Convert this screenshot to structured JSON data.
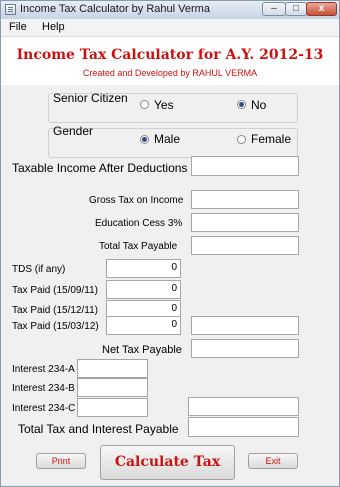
{
  "window": {
    "title": "Income Tax Calculator by Rahul Verma",
    "controls": {
      "minimize": "–",
      "maximize": "□",
      "close": "x"
    }
  },
  "menu": [
    {
      "label": "File"
    },
    {
      "label": "Help"
    }
  ],
  "header": {
    "title": "Income Tax Calculator for A.Y. 2012-13",
    "subtitle": "Created and Developed by RAHUL VERMA"
  },
  "senior_citizen": {
    "label": "Senior Citizen",
    "yes": "Yes",
    "no": "No",
    "selected": "No"
  },
  "gender": {
    "label": "Gender",
    "male": "Male",
    "female": "Female",
    "selected": "Male"
  },
  "fields": {
    "taxable_income": {
      "label": "Taxable Income After Deductions",
      "value": ""
    },
    "gross_tax": {
      "label": "Gross Tax on Income",
      "value": ""
    },
    "education_cess": {
      "label": "Education Cess 3%",
      "value": ""
    },
    "total_tax": {
      "label": "Total Tax Payable",
      "value": ""
    },
    "tds": {
      "label": "TDS (if any)",
      "value": "0"
    },
    "tax_paid_1": {
      "label": "Tax Paid (15/09/11)",
      "value": "0"
    },
    "tax_paid_2": {
      "label": "Tax Paid (15/12/11)",
      "value": "0"
    },
    "tax_paid_3": {
      "label": "Tax Paid (15/03/12)",
      "value": "0",
      "result": ""
    },
    "net_tax": {
      "label": "Net Tax Payable",
      "value": ""
    },
    "interest_234a": {
      "label": "Interest 234-A",
      "value": ""
    },
    "interest_234b": {
      "label": "Interest 234-B",
      "value": ""
    },
    "interest_234c": {
      "label": "Interest 234-C",
      "value": "",
      "result": ""
    },
    "total_tax_interest": {
      "label": "Total Tax and Interest Payable",
      "value": ""
    }
  },
  "buttons": {
    "print": "Print",
    "calculate": "Calculate Tax",
    "exit": "Exit"
  }
}
